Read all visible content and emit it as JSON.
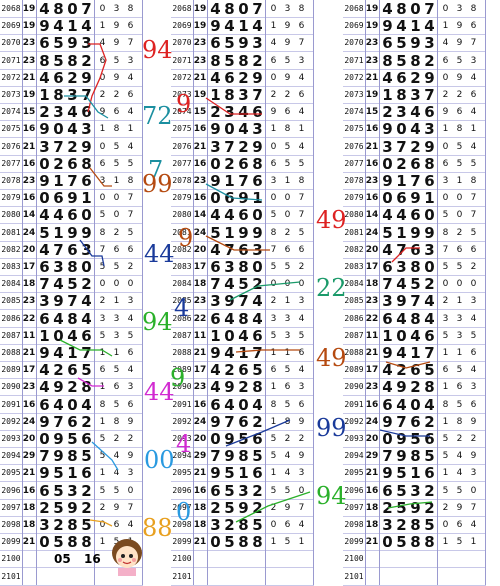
{
  "issues": [
    "2068",
    "2069",
    "2070",
    "2071",
    "2072",
    "2073",
    "2074",
    "2075",
    "2076",
    "2077",
    "2078",
    "2079",
    "2080",
    "2081",
    "2082",
    "2083",
    "2084",
    "2085",
    "2086",
    "2087",
    "2088",
    "2089",
    "2090",
    "2091",
    "2092",
    "2093",
    "2094",
    "2095",
    "2096",
    "2097",
    "2098",
    "2099",
    "2100",
    "2101"
  ],
  "sums": [
    "19",
    "19",
    "23",
    "23",
    "21",
    "19",
    "15",
    "16",
    "21",
    "16",
    "23",
    "16",
    "14",
    "24",
    "20",
    "17",
    "18",
    "23",
    "22",
    "11",
    "21",
    "17",
    "23",
    "16",
    "24",
    "20",
    "29",
    "21",
    "16",
    "18",
    "18",
    "21",
    "",
    ""
  ],
  "big": [
    "4807",
    "9414",
    "6593",
    "8582",
    "4629",
    "1837",
    "2346",
    "9043",
    "3729",
    "0268",
    "9176",
    "0691",
    "4460",
    "5199",
    "4763",
    "6380",
    "7452",
    "3974",
    "6484",
    "1046",
    "9417",
    "4265",
    "4928",
    "6404",
    "9762",
    "0956",
    "7985",
    "9516",
    "6532",
    "2592",
    "3285",
    "0588",
    "",
    ""
  ],
  "small": [
    "038",
    "196",
    "497",
    "653",
    "094",
    "226",
    "964",
    "181",
    "054",
    "655",
    "318",
    "007",
    "507",
    "825",
    "766",
    "552",
    "000",
    "213",
    "334",
    "535",
    "116",
    "654",
    "163",
    "856",
    "189",
    "522",
    "549",
    "143",
    "550",
    "297",
    "064",
    "151",
    "",
    ""
  ],
  "annotations": [
    {
      "text": "94",
      "color": "#dd2222"
    },
    {
      "text": "9",
      "color": "#dd2222"
    },
    {
      "text": "72",
      "color": "#1b8fa0"
    },
    {
      "text": "7",
      "color": "#1b8fa0"
    },
    {
      "text": "99",
      "color": "#b54a10"
    },
    {
      "text": "9",
      "color": "#b54a10"
    },
    {
      "text": "44",
      "color": "#1a3a9a"
    },
    {
      "text": "4",
      "color": "#1a3a9a"
    },
    {
      "text": "94",
      "color": "#2ab02a"
    },
    {
      "text": "9",
      "color": "#2ab02a"
    },
    {
      "text": "44",
      "color": "#d12ad1"
    },
    {
      "text": "4",
      "color": "#d12ad1"
    },
    {
      "text": "00",
      "color": "#2a9ae0"
    },
    {
      "text": "0",
      "color": "#2a9ae0"
    },
    {
      "text": "88",
      "color": "#e8a020"
    },
    {
      "text": "49",
      "color": "#dd2222"
    },
    {
      "text": "22",
      "color": "#1b9a6a"
    },
    {
      "text": "49",
      "color": "#b54a10"
    },
    {
      "text": "99",
      "color": "#1a3a9a"
    },
    {
      "text": "94",
      "color": "#2ab02a"
    }
  ],
  "bottom": {
    "left": "05",
    "right": "16"
  }
}
